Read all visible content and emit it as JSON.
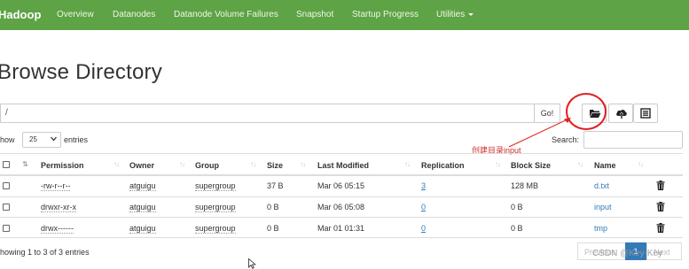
{
  "navbar": {
    "brand": "Hadoop",
    "items": [
      "Overview",
      "Datanodes",
      "Datanode Volume Failures",
      "Snapshot",
      "Startup Progress",
      "Utilities"
    ]
  },
  "page": {
    "title": "Browse Directory"
  },
  "path_bar": {
    "path": "/",
    "go_label": "Go!",
    "icons": [
      "folder-open-icon",
      "upload-icon",
      "list-icon"
    ]
  },
  "annotation": {
    "text": "创建目录input",
    "color": "#d42828"
  },
  "length_menu": {
    "show_label": "how",
    "value": "25",
    "entries_label": "entries"
  },
  "search": {
    "label": "Search:",
    "value": ""
  },
  "table": {
    "headers": {
      "permission": "Permission",
      "owner": "Owner",
      "group": "Group",
      "size": "Size",
      "last_modified": "Last Modified",
      "replication": "Replication",
      "block_size": "Block Size",
      "name": "Name"
    },
    "rows": [
      {
        "permission": "-rw-r--r--",
        "owner": "atguigu",
        "group": "supergroup",
        "size": "37 B",
        "last_modified": "Mar 06 05:15",
        "replication": "3",
        "block_size": "128 MB",
        "name": "d.txt"
      },
      {
        "permission": "drwxr-xr-x",
        "owner": "atguigu",
        "group": "supergroup",
        "size": "0 B",
        "last_modified": "Mar 06 05:08",
        "replication": "0",
        "block_size": "0 B",
        "name": "input"
      },
      {
        "permission": "drwx------",
        "owner": "atguigu",
        "group": "supergroup",
        "size": "0 B",
        "last_modified": "Mar 01 01:31",
        "replication": "0",
        "block_size": "0 B",
        "name": "tmp"
      }
    ]
  },
  "footer": {
    "info": "howing 1 to 3 of 3 entries",
    "previous": "Previous",
    "current_page": "1",
    "next": "Next"
  },
  "watermark": "CSDN @Key-Key",
  "colors": {
    "navbar": "#5ea345",
    "link": "#337ab7",
    "annotation": "#e02020"
  }
}
